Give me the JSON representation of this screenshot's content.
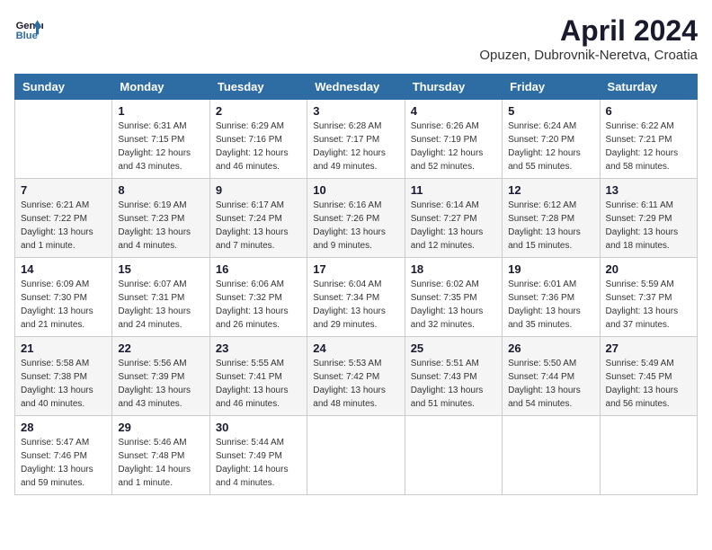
{
  "header": {
    "logo_line1": "General",
    "logo_line2": "Blue",
    "title": "April 2024",
    "location": "Opuzen, Dubrovnik-Neretva, Croatia"
  },
  "weekdays": [
    "Sunday",
    "Monday",
    "Tuesday",
    "Wednesday",
    "Thursday",
    "Friday",
    "Saturday"
  ],
  "weeks": [
    [
      {
        "day": "",
        "info": ""
      },
      {
        "day": "1",
        "info": "Sunrise: 6:31 AM\nSunset: 7:15 PM\nDaylight: 12 hours\nand 43 minutes."
      },
      {
        "day": "2",
        "info": "Sunrise: 6:29 AM\nSunset: 7:16 PM\nDaylight: 12 hours\nand 46 minutes."
      },
      {
        "day": "3",
        "info": "Sunrise: 6:28 AM\nSunset: 7:17 PM\nDaylight: 12 hours\nand 49 minutes."
      },
      {
        "day": "4",
        "info": "Sunrise: 6:26 AM\nSunset: 7:19 PM\nDaylight: 12 hours\nand 52 minutes."
      },
      {
        "day": "5",
        "info": "Sunrise: 6:24 AM\nSunset: 7:20 PM\nDaylight: 12 hours\nand 55 minutes."
      },
      {
        "day": "6",
        "info": "Sunrise: 6:22 AM\nSunset: 7:21 PM\nDaylight: 12 hours\nand 58 minutes."
      }
    ],
    [
      {
        "day": "7",
        "info": "Sunrise: 6:21 AM\nSunset: 7:22 PM\nDaylight: 13 hours\nand 1 minute."
      },
      {
        "day": "8",
        "info": "Sunrise: 6:19 AM\nSunset: 7:23 PM\nDaylight: 13 hours\nand 4 minutes."
      },
      {
        "day": "9",
        "info": "Sunrise: 6:17 AM\nSunset: 7:24 PM\nDaylight: 13 hours\nand 7 minutes."
      },
      {
        "day": "10",
        "info": "Sunrise: 6:16 AM\nSunset: 7:26 PM\nDaylight: 13 hours\nand 9 minutes."
      },
      {
        "day": "11",
        "info": "Sunrise: 6:14 AM\nSunset: 7:27 PM\nDaylight: 13 hours\nand 12 minutes."
      },
      {
        "day": "12",
        "info": "Sunrise: 6:12 AM\nSunset: 7:28 PM\nDaylight: 13 hours\nand 15 minutes."
      },
      {
        "day": "13",
        "info": "Sunrise: 6:11 AM\nSunset: 7:29 PM\nDaylight: 13 hours\nand 18 minutes."
      }
    ],
    [
      {
        "day": "14",
        "info": "Sunrise: 6:09 AM\nSunset: 7:30 PM\nDaylight: 13 hours\nand 21 minutes."
      },
      {
        "day": "15",
        "info": "Sunrise: 6:07 AM\nSunset: 7:31 PM\nDaylight: 13 hours\nand 24 minutes."
      },
      {
        "day": "16",
        "info": "Sunrise: 6:06 AM\nSunset: 7:32 PM\nDaylight: 13 hours\nand 26 minutes."
      },
      {
        "day": "17",
        "info": "Sunrise: 6:04 AM\nSunset: 7:34 PM\nDaylight: 13 hours\nand 29 minutes."
      },
      {
        "day": "18",
        "info": "Sunrise: 6:02 AM\nSunset: 7:35 PM\nDaylight: 13 hours\nand 32 minutes."
      },
      {
        "day": "19",
        "info": "Sunrise: 6:01 AM\nSunset: 7:36 PM\nDaylight: 13 hours\nand 35 minutes."
      },
      {
        "day": "20",
        "info": "Sunrise: 5:59 AM\nSunset: 7:37 PM\nDaylight: 13 hours\nand 37 minutes."
      }
    ],
    [
      {
        "day": "21",
        "info": "Sunrise: 5:58 AM\nSunset: 7:38 PM\nDaylight: 13 hours\nand 40 minutes."
      },
      {
        "day": "22",
        "info": "Sunrise: 5:56 AM\nSunset: 7:39 PM\nDaylight: 13 hours\nand 43 minutes."
      },
      {
        "day": "23",
        "info": "Sunrise: 5:55 AM\nSunset: 7:41 PM\nDaylight: 13 hours\nand 46 minutes."
      },
      {
        "day": "24",
        "info": "Sunrise: 5:53 AM\nSunset: 7:42 PM\nDaylight: 13 hours\nand 48 minutes."
      },
      {
        "day": "25",
        "info": "Sunrise: 5:51 AM\nSunset: 7:43 PM\nDaylight: 13 hours\nand 51 minutes."
      },
      {
        "day": "26",
        "info": "Sunrise: 5:50 AM\nSunset: 7:44 PM\nDaylight: 13 hours\nand 54 minutes."
      },
      {
        "day": "27",
        "info": "Sunrise: 5:49 AM\nSunset: 7:45 PM\nDaylight: 13 hours\nand 56 minutes."
      }
    ],
    [
      {
        "day": "28",
        "info": "Sunrise: 5:47 AM\nSunset: 7:46 PM\nDaylight: 13 hours\nand 59 minutes."
      },
      {
        "day": "29",
        "info": "Sunrise: 5:46 AM\nSunset: 7:48 PM\nDaylight: 14 hours\nand 1 minute."
      },
      {
        "day": "30",
        "info": "Sunrise: 5:44 AM\nSunset: 7:49 PM\nDaylight: 14 hours\nand 4 minutes."
      },
      {
        "day": "",
        "info": ""
      },
      {
        "day": "",
        "info": ""
      },
      {
        "day": "",
        "info": ""
      },
      {
        "day": "",
        "info": ""
      }
    ]
  ]
}
